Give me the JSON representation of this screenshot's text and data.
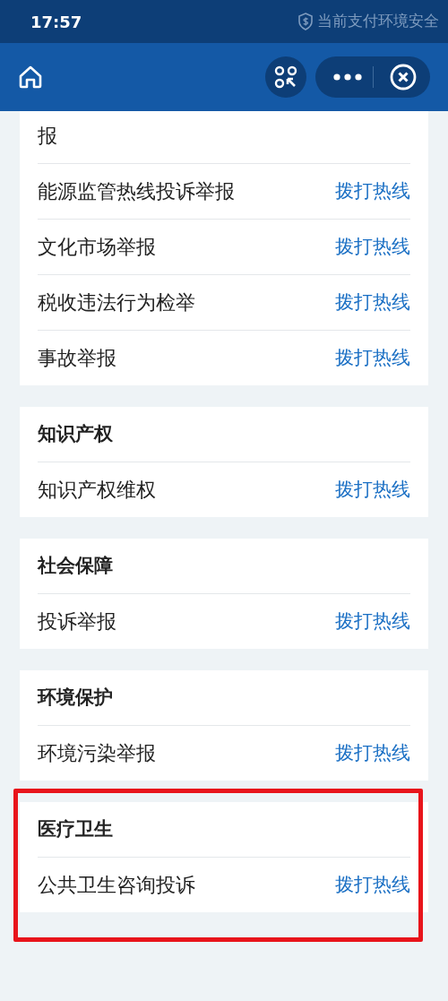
{
  "status_bar": {
    "time": "17:57",
    "security_text": "当前支付环境安全"
  },
  "sections": [
    {
      "highlighted": false,
      "items": [
        {
          "label": "报"
        },
        {
          "label": "能源监管热线投诉举报",
          "action": "拨打热线"
        },
        {
          "label": "文化市场举报",
          "action": "拨打热线"
        },
        {
          "label": "税收违法行为检举",
          "action": "拨打热线"
        },
        {
          "label": "事故举报",
          "action": "拨打热线"
        }
      ]
    },
    {
      "title": "知识产权",
      "highlighted": false,
      "items": [
        {
          "label": "知识产权维权",
          "action": "拨打热线"
        }
      ]
    },
    {
      "title": "社会保障",
      "highlighted": false,
      "items": [
        {
          "label": "投诉举报",
          "action": "拨打热线"
        }
      ]
    },
    {
      "title": "环境保护",
      "highlighted": false,
      "items": [
        {
          "label": "环境污染举报",
          "action": "拨打热线"
        }
      ]
    },
    {
      "title": "医疗卫生",
      "highlighted": true,
      "items": [
        {
          "label": "公共卫生咨询投诉",
          "action": "拨打热线"
        }
      ]
    }
  ]
}
